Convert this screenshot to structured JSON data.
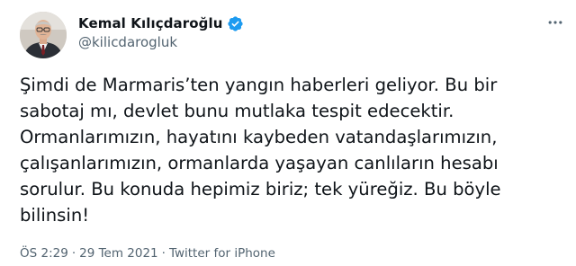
{
  "author": {
    "display_name": "Kemal Kılıçdaroğlu",
    "handle": "@kilicdarogluk",
    "verified": true,
    "avatar_icon": "profile-photo",
    "verified_color": "#1d9bf0"
  },
  "tweet": {
    "text": "Şimdi de Marmaris’ten yangın haberleri geliyor. Bu bir\nsabotaj mı, devlet bunu mutlaka tespit edecektir.\nOrmanlarımızın, hayatını kaybeden vatandaşlarımızın,\nçalışanlarımızın, ormanlarda yaşayan canlıların hesabı\nsorulur. Bu konuda hepimiz biriz; tek yüreğiz. Bu böyle\nbilinsin!",
    "time": "ÖS 2:29",
    "date": "29 Tem 2021",
    "separator": "·",
    "source": "Twitter for iPhone"
  },
  "icons": {
    "more": "more-horizontal-icon",
    "verified": "verified-badge-icon"
  }
}
